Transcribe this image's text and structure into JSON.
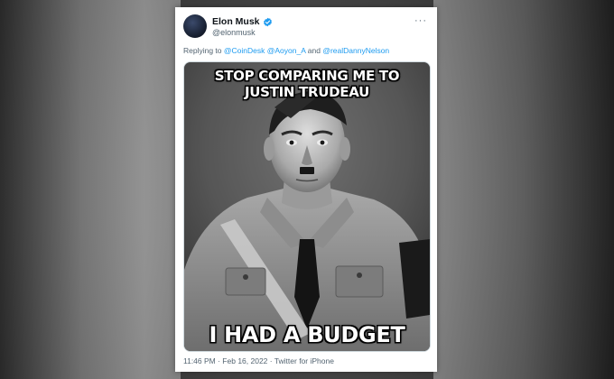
{
  "tweet": {
    "display_name": "Elon Musk",
    "handle": "@elonmusk",
    "more_label": "···",
    "reply_prefix": "Replying to ",
    "mentions": [
      "@CoinDesk",
      "@Aoyon_A",
      "@realDannyNelson"
    ],
    "reply_joiner": " and ",
    "meme_top_text": "STOP COMPARING ME TO JUSTIN TRUDEAU",
    "meme_bottom_text": "I HAD A BUDGET",
    "timestamp": "11:46 PM · Feb 16, 2022 · Twitter for iPhone"
  },
  "colors": {
    "link": "#1d9bf0",
    "verified": "#1d9bf0",
    "secondary_text": "#536471"
  },
  "icons": {
    "verified": "verified-badge-icon",
    "more": "more-options-icon"
  }
}
